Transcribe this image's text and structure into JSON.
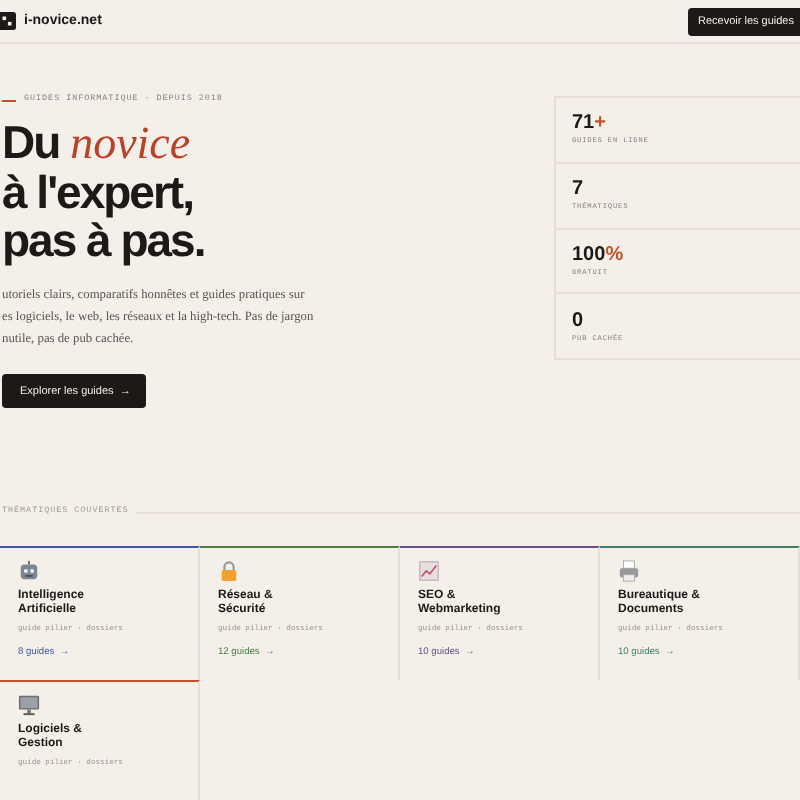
{
  "header": {
    "site_name": "i-novice.net",
    "cta": "Recevoir les guides"
  },
  "hero": {
    "eyebrow": "GUIDES INFORMATIQUE · DEPUIS 2018",
    "title_lines": [
      "Du *novice*",
      "à l'expert,",
      "pas à pas."
    ],
    "description_lines": [
      "utoriels clairs, comparatifs honnêtes et guides pratiques sur",
      "es logiciels, le web, les réseaux et la high-tech. Pas de jargon",
      "nutile, pas de pub cachée."
    ],
    "button": "Explorer les guides",
    "button_arrow": "→"
  },
  "stats": [
    {
      "value": "71",
      "suffix": "+",
      "label": "GUIDES EN LIGNE"
    },
    {
      "value": "7",
      "label": "THÉMATIQUES"
    },
    {
      "value": "100",
      "suffix": "%",
      "label": "GRATUIT"
    },
    {
      "value": "0",
      "label": "PUB CACHÉE"
    }
  ],
  "topics": {
    "heading": "THÉMATIQUES COUVERTES",
    "cards": [
      {
        "kind": "robot",
        "title": "Intelligence Artificielle",
        "subtitle": "guide pilier · dossiers",
        "link": "8 guides",
        "arrow": "→",
        "color": "#3d5a9e"
      },
      {
        "kind": "lock",
        "title": "Réseau & Sécurité",
        "subtitle": "guide pilier · dossiers",
        "link": "12 guides",
        "arrow": "→",
        "color": "#4e7d4a"
      },
      {
        "kind": "chart",
        "title": "SEO & Webmarketing",
        "subtitle": "guide pilier · dossiers",
        "link": "10 guides",
        "arrow": "→",
        "color": "#6a4f8f"
      },
      {
        "kind": "printer",
        "title": "Bureautique & Documents",
        "subtitle": "guide pilier · dossiers",
        "link": "10 guides",
        "arrow": "→",
        "color": "#3f7f66"
      },
      {
        "kind": "monitor",
        "title": "Logiciels & Gestion",
        "subtitle": "guide pilier · dossiers",
        "color": "#c0502e"
      }
    ]
  }
}
